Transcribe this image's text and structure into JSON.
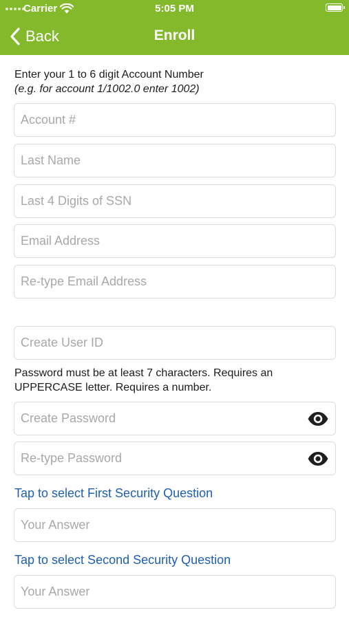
{
  "status_bar": {
    "carrier": "Carrier",
    "time": "5:05 PM"
  },
  "nav": {
    "back_label": "Back",
    "title": "Enroll"
  },
  "intro": {
    "line1": "Enter your 1 to 6 digit Account Number",
    "line2": "(e.g. for account 1/1002.0 enter 1002)"
  },
  "fields": {
    "account": {
      "placeholder": "Account #",
      "value": ""
    },
    "last_name": {
      "placeholder": "Last Name",
      "value": ""
    },
    "ssn_last4": {
      "placeholder": "Last 4 Digits of SSN",
      "value": ""
    },
    "email": {
      "placeholder": "Email Address",
      "value": ""
    },
    "email_confirm": {
      "placeholder": "Re-type Email Address",
      "value": ""
    },
    "user_id": {
      "placeholder": "Create User ID",
      "value": ""
    },
    "password": {
      "placeholder": "Create Password",
      "value": ""
    },
    "password_confirm": {
      "placeholder": "Re-type Password",
      "value": ""
    },
    "answer1": {
      "placeholder": "Your Answer",
      "value": ""
    },
    "answer2": {
      "placeholder": "Your Answer",
      "value": ""
    }
  },
  "password_note": "Password must be at least 7 characters. Requires an UPPERCASE letter. Requires a number.",
  "security": {
    "first_label": "Tap to select First Security Question",
    "second_label": "Tap to select Second Security Question"
  },
  "icons": {
    "back": "chevron-left-icon",
    "wifi": "wifi-icon",
    "battery": "battery-icon",
    "eye": "eye-icon"
  },
  "colors": {
    "header_bg": "#84b92c",
    "link": "#1e5fb0",
    "placeholder": "#a8a8a8",
    "field_border": "#dcdcdc"
  }
}
